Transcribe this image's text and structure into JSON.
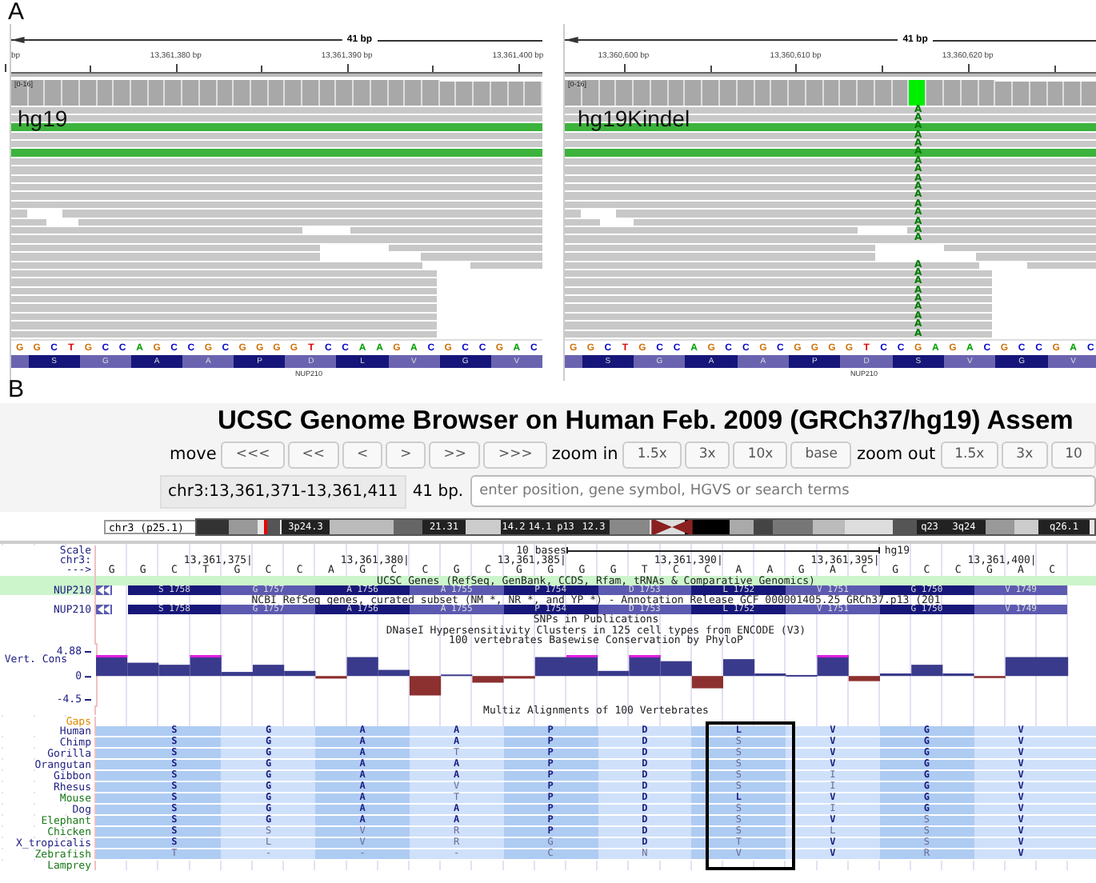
{
  "figure_a": {
    "label": "A",
    "panels": [
      {
        "ruler": {
          "span": "41 bp",
          "ticks": [
            "bp",
            "13,361,380 bp",
            "13,361,390 bp",
            "13,361,400 bp"
          ]
        },
        "coverage_range": "[0-16]",
        "track_label": "hg19",
        "gene": "NUP210",
        "reference": [
          {
            "base": "G",
            "color": "#d17105",
            "variant": false
          },
          {
            "base": "G",
            "color": "#d17105",
            "variant": false
          },
          {
            "base": "C",
            "color": "#0000c8",
            "variant": false
          },
          {
            "base": "T",
            "color": "#e00000",
            "variant": false
          },
          {
            "base": "G",
            "color": "#d17105",
            "variant": false
          },
          {
            "base": "C",
            "color": "#0000c8",
            "variant": false
          },
          {
            "base": "C",
            "color": "#0000c8",
            "variant": false
          },
          {
            "base": "A",
            "color": "#00a000",
            "variant": false
          },
          {
            "base": "G",
            "color": "#d17105",
            "variant": false
          },
          {
            "base": "C",
            "color": "#0000c8",
            "variant": false
          },
          {
            "base": "C",
            "color": "#0000c8",
            "variant": false
          },
          {
            "base": "G",
            "color": "#d17105",
            "variant": false
          },
          {
            "base": "C",
            "color": "#0000c8",
            "variant": false
          },
          {
            "base": "G",
            "color": "#d17105",
            "variant": false
          },
          {
            "base": "G",
            "color": "#d17105",
            "variant": false
          },
          {
            "base": "G",
            "color": "#d17105",
            "variant": false
          },
          {
            "base": "G",
            "color": "#d17105",
            "variant": false
          },
          {
            "base": "T",
            "color": "#e00000",
            "variant": false
          },
          {
            "base": "C",
            "color": "#0000c8",
            "variant": false
          },
          {
            "base": "C",
            "color": "#0000c8",
            "variant": false
          },
          {
            "base": "A",
            "color": "#00a000",
            "variant": false
          },
          {
            "base": "A",
            "color": "#00a000",
            "variant": false
          },
          {
            "base": "G",
            "color": "#d17105",
            "variant": false
          },
          {
            "base": "A",
            "color": "#00a000",
            "variant": false
          },
          {
            "base": "C",
            "color": "#0000c8",
            "variant": false
          },
          {
            "base": "G",
            "color": "#d17105",
            "variant": false
          },
          {
            "base": "C",
            "color": "#0000c8",
            "variant": false
          },
          {
            "base": "C",
            "color": "#0000c8",
            "variant": false
          },
          {
            "base": "G",
            "color": "#d17105",
            "variant": false
          },
          {
            "base": "A",
            "color": "#00a000",
            "variant": false
          },
          {
            "base": "C",
            "color": "#0000c8",
            "variant": false
          }
        ],
        "translation": [
          "S",
          "G",
          "A",
          "A",
          "P",
          "D",
          "L",
          "V",
          "G",
          "V"
        ]
      },
      {
        "ruler": {
          "span": "41 bp",
          "ticks": [
            "13,360,600 bp",
            "13,360,610 bp",
            "13,360,620 bp"
          ]
        },
        "coverage_range": "[0-16]",
        "track_label": "hg19Kindel",
        "gene": "NUP210",
        "reference": [
          {
            "base": "G",
            "color": "#d17105",
            "variant": false
          },
          {
            "base": "G",
            "color": "#d17105",
            "variant": false
          },
          {
            "base": "C",
            "color": "#0000c8",
            "variant": false
          },
          {
            "base": "T",
            "color": "#e00000",
            "variant": false
          },
          {
            "base": "G",
            "color": "#d17105",
            "variant": false
          },
          {
            "base": "C",
            "color": "#0000c8",
            "variant": false
          },
          {
            "base": "C",
            "color": "#0000c8",
            "variant": false
          },
          {
            "base": "A",
            "color": "#00a000",
            "variant": false
          },
          {
            "base": "G",
            "color": "#d17105",
            "variant": false
          },
          {
            "base": "C",
            "color": "#0000c8",
            "variant": false
          },
          {
            "base": "C",
            "color": "#0000c8",
            "variant": false
          },
          {
            "base": "G",
            "color": "#d17105",
            "variant": false
          },
          {
            "base": "C",
            "color": "#0000c8",
            "variant": false
          },
          {
            "base": "G",
            "color": "#d17105",
            "variant": false
          },
          {
            "base": "G",
            "color": "#d17105",
            "variant": false
          },
          {
            "base": "G",
            "color": "#d17105",
            "variant": false
          },
          {
            "base": "G",
            "color": "#d17105",
            "variant": false
          },
          {
            "base": "T",
            "color": "#e00000",
            "variant": false
          },
          {
            "base": "C",
            "color": "#0000c8",
            "variant": false
          },
          {
            "base": "C",
            "color": "#0000c8",
            "variant": false
          },
          {
            "base": "G",
            "color": "#d17105",
            "variant": true
          },
          {
            "base": "A",
            "color": "#00a000",
            "variant": false
          },
          {
            "base": "G",
            "color": "#d17105",
            "variant": false
          },
          {
            "base": "A",
            "color": "#00a000",
            "variant": false
          },
          {
            "base": "C",
            "color": "#0000c8",
            "variant": false
          },
          {
            "base": "G",
            "color": "#d17105",
            "variant": false
          },
          {
            "base": "C",
            "color": "#0000c8",
            "variant": false
          },
          {
            "base": "C",
            "color": "#0000c8",
            "variant": false
          },
          {
            "base": "G",
            "color": "#d17105",
            "variant": false
          },
          {
            "base": "A",
            "color": "#00a000",
            "variant": false
          },
          {
            "base": "C",
            "color": "#0000c8",
            "variant": false
          }
        ],
        "translation": [
          "S",
          "G",
          "A",
          "A",
          "P",
          "D",
          "S",
          "V",
          "G",
          "V"
        ],
        "read_bases": [
          "A",
          "A",
          "A",
          "A",
          "A",
          "A",
          "A",
          "A",
          "A",
          "A",
          "A",
          "A",
          "A",
          "A",
          "A",
          "A",
          "A",
          "A",
          "A",
          "A",
          "A",
          "A",
          "A",
          "A",
          "A"
        ]
      }
    ]
  },
  "figure_b": {
    "label": "B",
    "title": "UCSC Genome Browser on Human Feb. 2009 (GRCh37/hg19) Assem",
    "nav": {
      "move_label": "move",
      "move_buttons": [
        "<<<",
        "<<",
        "<",
        ">",
        ">>",
        ">>>"
      ],
      "zoom_in_label": "zoom in",
      "zoom_in_buttons": [
        "1.5x",
        "3x",
        "10x",
        "base"
      ],
      "zoom_out_label": "zoom out",
      "zoom_out_buttons": [
        "1.5x",
        "3x",
        "10"
      ]
    },
    "position": "chr3:13,361,371-13,361,411",
    "size": "41 bp.",
    "search": {
      "placeholder": "enter position, gene symbol, HGVS or search terms"
    },
    "ideogram": {
      "label": "chr3 (p25.1)",
      "bands": [
        "3p24.3",
        "21.31",
        "14.2",
        "14.1",
        "p13",
        "12.3",
        "q23",
        "3q24",
        "q26.1"
      ]
    },
    "scale": {
      "label": "Scale",
      "bar": "10 bases",
      "assembly": "hg19"
    },
    "chrom": {
      "label": "chr3:",
      "positions": [
        "13,361,375|",
        "13,361,380|",
        "13,361,385|",
        "13,361,390|",
        "13,361,395|",
        "13,361,400|"
      ]
    },
    "strand": {
      "label": "--->",
      "bases": [
        "G",
        "G",
        "C",
        "T",
        "G",
        "C",
        "C",
        "A",
        "G",
        "C",
        "C",
        "G",
        "C",
        "G",
        "G",
        "G",
        "G",
        "T",
        "C",
        "C",
        "A",
        "A",
        "G",
        "A",
        "C",
        "G",
        "C",
        "C",
        "G",
        "A",
        "C"
      ]
    },
    "gene_tracks": [
      {
        "title": "UCSC Genes (RefSeq, GenBank, CCDS, Rfam, tRNAs & Comparative Genomics)",
        "name": "NUP210",
        "highlight": true,
        "exons": [
          "S 1758",
          "G 1757",
          "A 1756",
          "A 1755",
          "P 1754",
          "D 1753",
          "L 1752",
          "V 1751",
          "G 1750",
          "V 1749"
        ]
      },
      {
        "title": "NCBI RefSeq genes, curated subset (NM_*, NR_*, and YP_*) - Annotation Release GCF_000001405.25_GRCh37.p13 (201",
        "name": "NUP210",
        "highlight": false,
        "exons": [
          "S 1758",
          "G 1757",
          "A 1756",
          "A 1755",
          "P 1754",
          "D 1753",
          "L 1752",
          "V 1751",
          "G 1750",
          "V 1749"
        ]
      }
    ],
    "track_titles": [
      "SNPs in Publications",
      "DNaseI Hypersensitivity Clusters in 125 cell types from ENCODE (V3)",
      "100 vertebrates Basewise Conservation by PhyloP"
    ],
    "conservation": {
      "label": "Vert. Cons",
      "tick_labels": [
        "4.88",
        "0",
        "-4.5"
      ]
    },
    "alignment": {
      "title": "Multiz Alignments of 100 Vertebrates",
      "gaps_label": "Gaps",
      "species": [
        {
          "name": "Human",
          "color": "#1c1c80",
          "aa": [
            "S",
            "G",
            "A",
            "A",
            "P",
            "D",
            "L",
            "V",
            "G",
            "V"
          ]
        },
        {
          "name": "Chimp",
          "color": "#1c1c80",
          "aa": [
            "S",
            "G",
            "A",
            "A",
            "P",
            "D",
            "S",
            "V",
            "G",
            "V"
          ]
        },
        {
          "name": "Gorilla",
          "color": "#1c1c80",
          "aa": [
            "S",
            "G",
            "A",
            "T",
            "P",
            "D",
            "S",
            "V",
            "G",
            "V"
          ]
        },
        {
          "name": "Orangutan",
          "color": "#1c1c80",
          "aa": [
            "S",
            "G",
            "A",
            "A",
            "P",
            "D",
            "S",
            "V",
            "G",
            "V"
          ]
        },
        {
          "name": "Gibbon",
          "color": "#1c1c80",
          "aa": [
            "S",
            "G",
            "A",
            "A",
            "P",
            "D",
            "S",
            "I",
            "G",
            "V"
          ]
        },
        {
          "name": "Rhesus",
          "color": "#1c1c80",
          "aa": [
            "S",
            "G",
            "A",
            "V",
            "P",
            "D",
            "S",
            "I",
            "G",
            "V"
          ]
        },
        {
          "name": "Mouse",
          "color": "#1a7a1a",
          "aa": [
            "S",
            "G",
            "A",
            "T",
            "P",
            "D",
            "L",
            "V",
            "G",
            "V"
          ]
        },
        {
          "name": "Dog",
          "color": "#1c1c80",
          "aa": [
            "S",
            "G",
            "A",
            "A",
            "P",
            "D",
            "S",
            "I",
            "G",
            "V"
          ]
        },
        {
          "name": "Elephant",
          "color": "#1a7a1a",
          "aa": [
            "S",
            "G",
            "A",
            "A",
            "P",
            "D",
            "S",
            "V",
            "S",
            "V"
          ]
        },
        {
          "name": "Chicken",
          "color": "#1a7a1a",
          "aa": [
            "S",
            "S",
            "V",
            "R",
            "P",
            "D",
            "S",
            "L",
            "S",
            "V"
          ]
        },
        {
          "name": "X_tropicalis",
          "color": "#1c1c80",
          "aa": [
            "S",
            "L",
            "V",
            "R",
            "G",
            "D",
            "T",
            "V",
            "S",
            "V"
          ]
        },
        {
          "name": "Zebrafish",
          "color": "#1a7a1a",
          "aa": [
            "T",
            "-",
            "-",
            "-",
            "C",
            "N",
            "V",
            "V",
            "R",
            "V"
          ]
        },
        {
          "name": "Lamprey",
          "color": "#1a7a1a"
        }
      ]
    }
  }
}
